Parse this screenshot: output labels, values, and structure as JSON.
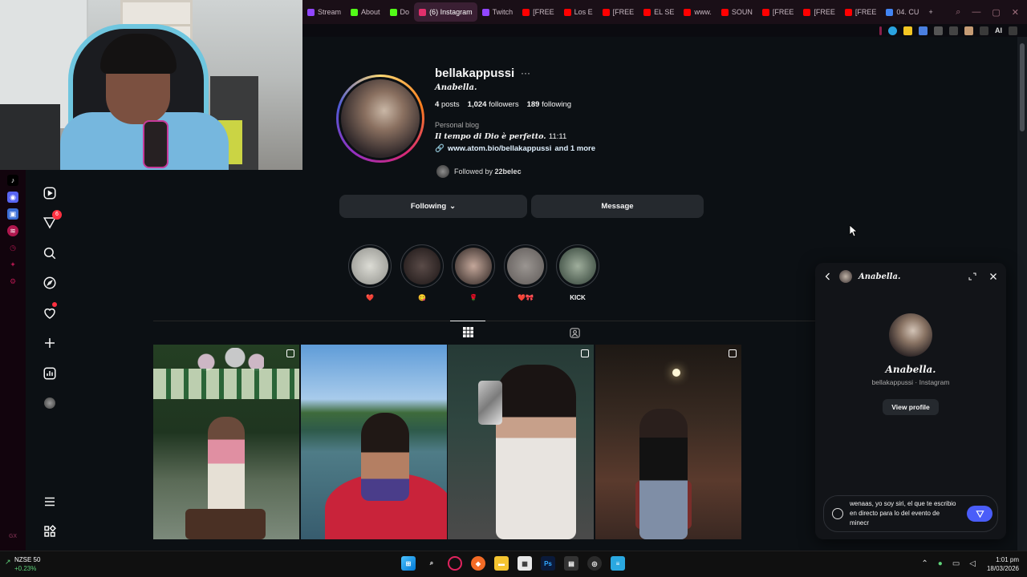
{
  "browser": {
    "tabs": [
      {
        "label": "Stream",
        "color": "#9146ff"
      },
      {
        "label": "About",
        "color": "#53fc18"
      },
      {
        "label": "Do",
        "color": "#53fc18"
      },
      {
        "label": "(6) Instagram",
        "color": "#e1306c",
        "active": true
      },
      {
        "label": "Twitch",
        "color": "#9146ff"
      },
      {
        "label": "[FREE",
        "color": "#ff0000"
      },
      {
        "label": "Los E",
        "color": "#ff0000"
      },
      {
        "label": "[FREE",
        "color": "#ff0000"
      },
      {
        "label": "EL SE",
        "color": "#ff0000"
      },
      {
        "label": "www.",
        "color": "#ff0000"
      },
      {
        "label": "SOUN",
        "color": "#ff0000"
      },
      {
        "label": "[FREE",
        "color": "#ff0000"
      },
      {
        "label": "[FREE",
        "color": "#ff0000"
      },
      {
        "label": "[FREE",
        "color": "#ff0000"
      },
      {
        "label": "04. CU",
        "color": "#4285f4"
      }
    ],
    "new_tab": "+",
    "ext_ai_label": "AI"
  },
  "gx_sidebar": {
    "bottom_label": "GX"
  },
  "instagram_nav": {
    "notifications_badge": "6"
  },
  "profile": {
    "username": "bellakappussi",
    "more": "···",
    "full_name": "Anabella.",
    "posts_count": "4",
    "posts_label": "posts",
    "followers_count": "1,024",
    "followers_label": "followers",
    "following_count": "189",
    "following_label": "following",
    "category": "Personal blog",
    "bio_italic": "Il tempo di Dio è perfetto.",
    "bio_time": "11:11",
    "link": "www.atom.bio/bellakappussi",
    "link_more": "and 1 more",
    "followed_by_prefix": "Followed by",
    "followed_by_user": "22belec",
    "following_button": "Following",
    "message_button": "Message"
  },
  "highlights": [
    {
      "label": "❤️"
    },
    {
      "label": "😋"
    },
    {
      "label": "🌹"
    },
    {
      "label": "❤️🎀"
    },
    {
      "label": "KICK"
    }
  ],
  "dm": {
    "header_name": "Anabella.",
    "name": "Anabella.",
    "subtitle": "bellakappussi · Instagram",
    "view_profile": "View profile",
    "draft_message": "wenaas, yo soy siri, el que te escribio en directo para lo del evento de minecr"
  },
  "taskbar": {
    "ticker_name": "NZSE 50",
    "ticker_change": "+0.23%",
    "time": "1:01 pm",
    "date": "18/03/2026"
  }
}
